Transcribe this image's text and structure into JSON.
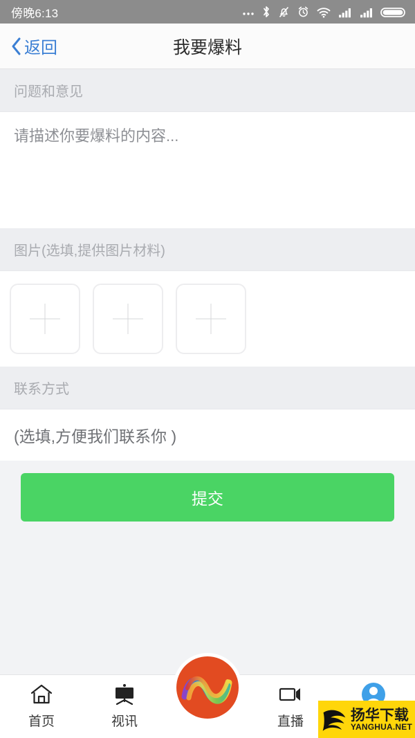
{
  "statusbar": {
    "time": "傍晚6:13",
    "icons": [
      "more-dots-icon",
      "bluetooth-icon",
      "vibrate-off-icon",
      "alarm-clock-icon",
      "wifi-icon",
      "signal-bars-icon",
      "signal-bars-icon",
      "battery-icon"
    ]
  },
  "header": {
    "back_label": "返回",
    "back_icon": "chevron-left-icon",
    "title": "我要爆料",
    "back_color": "#3b7fd4"
  },
  "form": {
    "content_section_label": "问题和意见",
    "content_placeholder": "请描述你要爆料的内容...",
    "image_section_label": "图片(选填,提供图片材料)",
    "upload_slots": [
      "add-photo-1",
      "add-photo-2",
      "add-photo-3"
    ],
    "upload_icon": "plus-icon",
    "contact_section_label": "联系方式",
    "contact_placeholder": "(选填,方便我们联系你 )",
    "submit_label": "提交",
    "submit_color": "#4ad464"
  },
  "tabbar": {
    "items": [
      {
        "label": "首页",
        "icon": "home-icon"
      },
      {
        "label": "视讯",
        "icon": "tv-easel-icon"
      },
      {
        "label": "",
        "icon": "app-logo-icon"
      },
      {
        "label": "直播",
        "icon": "video-camera-icon"
      },
      {
        "label": "",
        "icon": "user-profile-icon"
      }
    ],
    "center_logo_color": "#e24b21"
  },
  "watermark": {
    "cn": "扬华下载",
    "en": "YANGHUA.NET",
    "bg_color": "#ffd60a",
    "icon": "bird-logo-icon"
  }
}
